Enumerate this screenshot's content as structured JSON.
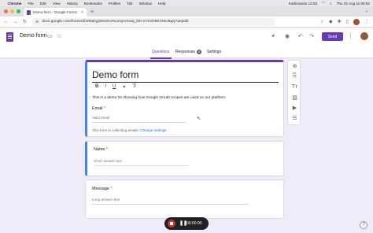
{
  "menubar": {
    "app": "Chrome",
    "items": [
      "File",
      "Edit",
      "View",
      "History",
      "Bookmarks",
      "Profiles",
      "Tab",
      "Window",
      "Help"
    ],
    "location": "Kathmandu 14:53",
    "datetime": "Thu 22 Aug 11:08:02"
  },
  "browser": {
    "tab_title": "Demo form - Google Forms",
    "url": "docs.google.com/forms/d/1Ri5DyjS8ntXnzNcZopVXxwj_ldH-eYIOOMCtNsJ9qQ7aejedit"
  },
  "forms_header": {
    "title": "Demo form",
    "send_label": "Send",
    "tabs": [
      {
        "label": "Questions"
      },
      {
        "label": "Responses",
        "badge": "3"
      },
      {
        "label": "Settings"
      }
    ]
  },
  "form": {
    "title": "Demo form",
    "description": "This is a demo for showing how Google OAuth scopes are used on our platform.",
    "email_label": "Email",
    "email_required": "*",
    "email_placeholder": "Valid email",
    "collecting_text": "This form is collecting emails.",
    "change_settings": "Change settings"
  },
  "questions": [
    {
      "label": "Name",
      "required": "*",
      "placeholder": "Short answer text"
    },
    {
      "label": "Message",
      "required": "*",
      "placeholder": "Long answer text"
    }
  ],
  "recorder": {
    "time": "00:00:00"
  },
  "help": "?",
  "colors": {
    "accent": "#673ab7",
    "background": "#f0ebf8",
    "focus": "#4285f4"
  }
}
